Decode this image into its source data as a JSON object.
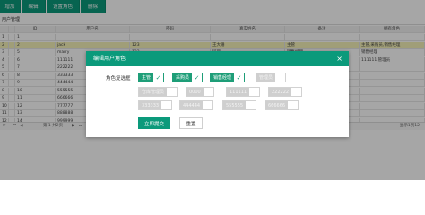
{
  "toolbar": {
    "buttons": [
      "增加",
      "编辑",
      "设置角色",
      "删除"
    ]
  },
  "page_title": "用户管理",
  "table": {
    "columns": [
      "ID",
      "用户名",
      "密码",
      "真实姓名",
      "备注",
      "拥有角色"
    ],
    "rows": [
      {
        "num": "1",
        "id": "1",
        "username": "",
        "password": "",
        "realname": "",
        "remark": "",
        "roles": ""
      },
      {
        "num": "2",
        "id": "2",
        "username": "jack",
        "password": "123",
        "realname": "王大锤",
        "remark": "主管",
        "roles": "主管,采购员,销售经理"
      },
      {
        "num": "3",
        "id": "5",
        "username": "marry",
        "password": "123",
        "realname": "玛丽",
        "remark": "销售经理",
        "roles": "销售经理"
      },
      {
        "num": "4",
        "id": "6",
        "username": "111111",
        "password": "111111",
        "realname": "",
        "remark": "",
        "roles": "111111,管理员"
      },
      {
        "num": "5",
        "id": "7",
        "username": "222222",
        "password": "",
        "realname": "",
        "remark": "",
        "roles": ""
      },
      {
        "num": "6",
        "id": "8",
        "username": "333333",
        "password": "",
        "realname": "",
        "remark": "",
        "roles": ""
      },
      {
        "num": "7",
        "id": "9",
        "username": "444444",
        "password": "",
        "realname": "",
        "remark": "",
        "roles": ""
      },
      {
        "num": "8",
        "id": "10",
        "username": "555555",
        "password": "",
        "realname": "",
        "remark": "",
        "roles": ""
      },
      {
        "num": "9",
        "id": "11",
        "username": "666666",
        "password": "",
        "realname": "",
        "remark": "",
        "roles": ""
      },
      {
        "num": "10",
        "id": "12",
        "username": "777777",
        "password": "",
        "realname": "",
        "remark": "",
        "roles": ""
      },
      {
        "num": "11",
        "id": "13",
        "username": "888888",
        "password": "",
        "realname": "",
        "remark": "",
        "roles": ""
      },
      {
        "num": "12",
        "id": "14",
        "username": "999999",
        "password": "",
        "realname": "",
        "remark": "",
        "roles": ""
      }
    ]
  },
  "pager": {
    "page_text": "第 1 共2页",
    "total_text": "显示1到12"
  },
  "modal": {
    "title": "编辑用户角色",
    "close_glyph": "×",
    "field_label": "角色复选框",
    "roles": [
      {
        "name": "主管",
        "checked": true
      },
      {
        "name": "采购员",
        "checked": true
      },
      {
        "name": "销售经理",
        "checked": true
      },
      {
        "name": "管理员",
        "checked": false
      },
      {
        "name": "仓库管理员",
        "checked": false
      },
      {
        "name": "0000",
        "checked": false
      },
      {
        "name": "111111",
        "checked": false
      },
      {
        "name": "222222",
        "checked": false
      },
      {
        "name": "333333",
        "checked": false
      },
      {
        "name": "444444",
        "checked": false
      },
      {
        "name": "555555",
        "checked": false
      },
      {
        "name": "666666",
        "checked": false
      }
    ],
    "submit_label": "立即提交",
    "reset_label": "重置"
  },
  "colors": {
    "primary": "#0b9a7b",
    "selected_row": "#f6f3b9"
  }
}
